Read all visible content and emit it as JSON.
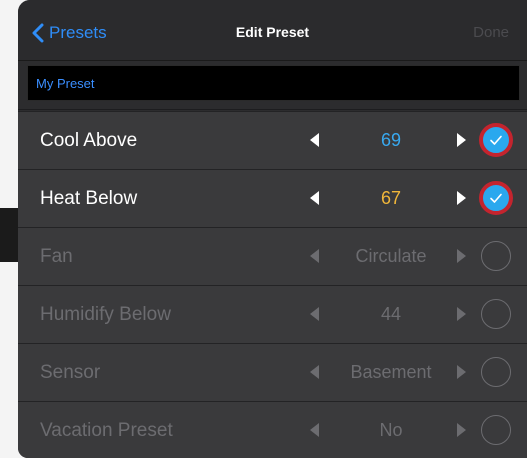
{
  "navbar": {
    "back_label": "Presets",
    "title": "Edit Preset",
    "done_label": "Done"
  },
  "preset_name": {
    "value": "My Preset"
  },
  "rows": [
    {
      "label": "Cool Above",
      "value": "69",
      "value_color": "#38a9f0",
      "active": true,
      "checked": true
    },
    {
      "label": "Heat Below",
      "value": "67",
      "value_color": "#f0b63a",
      "active": true,
      "checked": true
    },
    {
      "label": "Fan",
      "value": "Circulate",
      "active": false,
      "checked": false
    },
    {
      "label": "Humidify Below",
      "value": "44",
      "active": false,
      "checked": false
    },
    {
      "label": "Sensor",
      "value": "Basement",
      "active": false,
      "checked": false
    },
    {
      "label": "Vacation Preset",
      "value": "No",
      "active": false,
      "checked": false
    }
  ],
  "colors": {
    "accent_blue": "#2f8df7",
    "check_fill": "#2aa8ee",
    "check_ring": "#c4242e"
  }
}
